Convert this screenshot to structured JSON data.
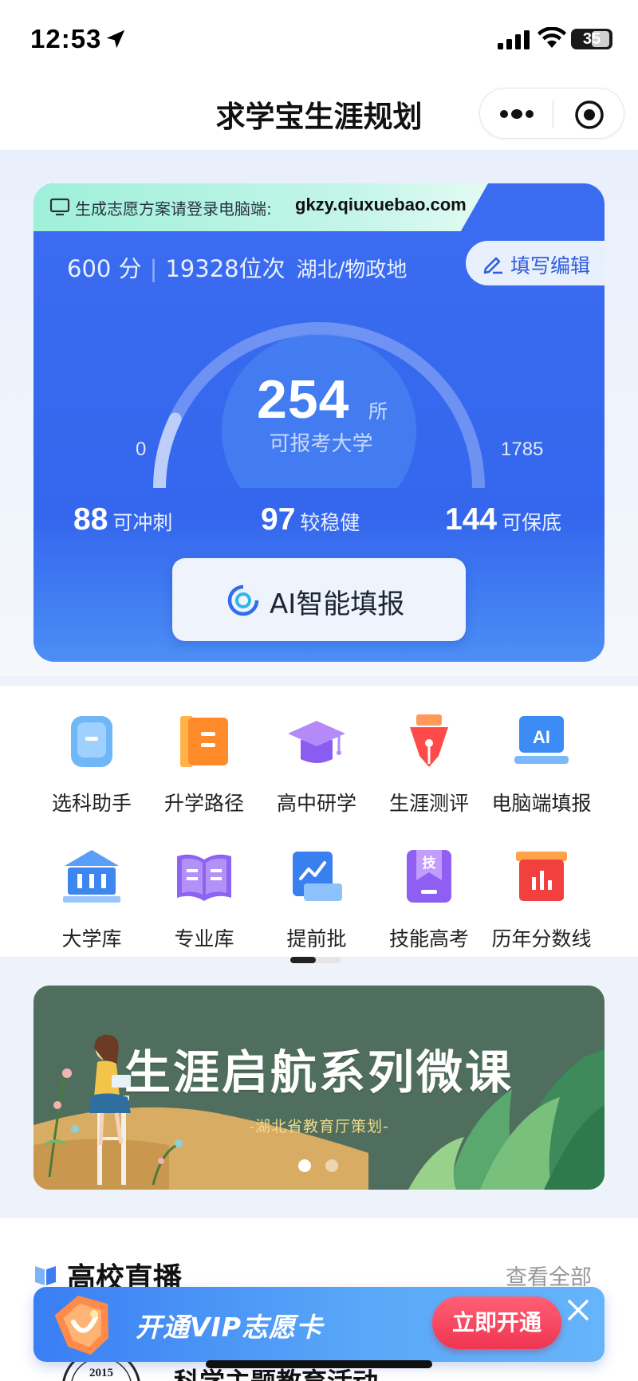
{
  "status_bar": {
    "time": "12:53",
    "battery": "35",
    "icons": [
      "location-arrow-icon",
      "signal-icon",
      "wifi-icon",
      "battery-icon"
    ]
  },
  "nav": {
    "title": "求学宝生涯规划",
    "icons": [
      "more-dots-icon",
      "target-icon"
    ]
  },
  "hero": {
    "banner_label": "生成志愿方案请登录电脑端:",
    "banner_url": "gkzy.qiuxuebao.com",
    "score": "600 分",
    "rank": "19328位次",
    "province": "湖北/物政地",
    "edit_label": "填写编辑",
    "gauge": {
      "min": "0",
      "max": "1785",
      "value": "254",
      "unit": "所",
      "sub": "可报考大学",
      "fraction": 0.1423
    },
    "stats": [
      {
        "num": "88",
        "label": "可冲刺"
      },
      {
        "num": "97",
        "label": "较稳健"
      },
      {
        "num": "144",
        "label": "可保底"
      }
    ],
    "ai_button": "AI智能填报",
    "colors": {
      "card": "#3467ee",
      "banner": "#bff3e3"
    }
  },
  "menu": {
    "items": [
      {
        "label": "选科助手",
        "icon": "backpack-icon"
      },
      {
        "label": "升学路径",
        "icon": "book-folder-icon"
      },
      {
        "label": "高中研学",
        "icon": "graduation-cap-icon"
      },
      {
        "label": "生涯测评",
        "icon": "pen-nib-icon"
      },
      {
        "label": "电脑端填报",
        "icon": "ai-monitor-icon"
      },
      {
        "label": "大学库",
        "icon": "university-building-icon"
      },
      {
        "label": "专业库",
        "icon": "open-book-icon"
      },
      {
        "label": "提前批",
        "icon": "chart-trend-icon"
      },
      {
        "label": "技能高考",
        "icon": "skill-badge-icon"
      },
      {
        "label": "历年分数线",
        "icon": "bar-chart-icon"
      }
    ],
    "page": 1,
    "page_count": 2
  },
  "banner": {
    "title": "生涯启航系列微课",
    "subtitle": "-湖北省教育厅策划-",
    "slide": 1,
    "slide_count": 2
  },
  "live": {
    "title": "高校直播",
    "more": "查看全部",
    "item_title": "科学主题教育活动",
    "logo_text": "2015"
  },
  "vip": {
    "text": "开通VIP志愿卡",
    "button": "立即开通",
    "colors": {
      "bar": "#4a95f6",
      "button": "#f23c56"
    }
  }
}
